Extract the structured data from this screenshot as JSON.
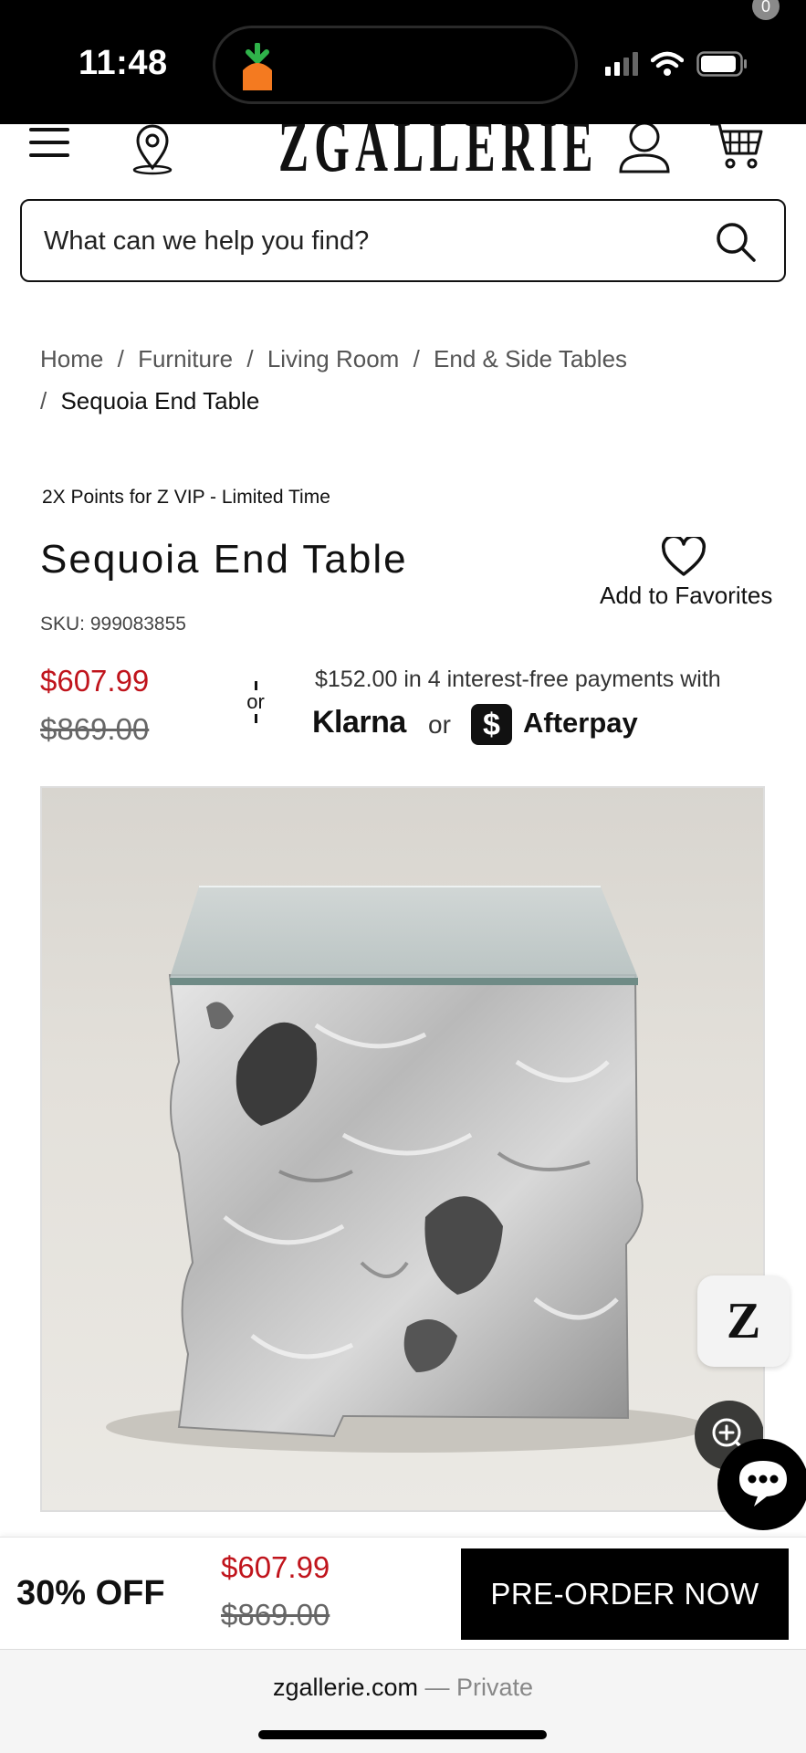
{
  "status_bar": {
    "time": "11:48"
  },
  "header": {
    "logo": "ZGALLERIE",
    "cart_count": "0"
  },
  "search": {
    "placeholder": "What can we help you find?"
  },
  "breadcrumb": {
    "items": [
      "Home",
      "Furniture",
      "Living Room",
      "End & Side Tables"
    ],
    "current": "Sequoia End Table",
    "separator": "/"
  },
  "product": {
    "promo": "2X Points for Z VIP - Limited Time",
    "title": "Sequoia End Table",
    "favorites_label": "Add to Favorites",
    "sku": "SKU: 999083855",
    "sale_price": "$607.99",
    "original_price": "$869.00",
    "or_label": "or",
    "installments": "$152.00 in 4 interest-free payments with",
    "klarna": "Klarna",
    "or_small": "or",
    "afterpay_glyph": "$",
    "afterpay": "Afterpay",
    "z_badge": "Z"
  },
  "bottom_bar": {
    "discount": "30% OFF",
    "sale_price": "$607.99",
    "original_price": "$869.00",
    "cta": "PRE-ORDER NOW"
  },
  "browser": {
    "domain": "zgallerie.com",
    "mode": "— Private"
  },
  "colors": {
    "sale_red": "#c0141c",
    "black": "#000000"
  }
}
